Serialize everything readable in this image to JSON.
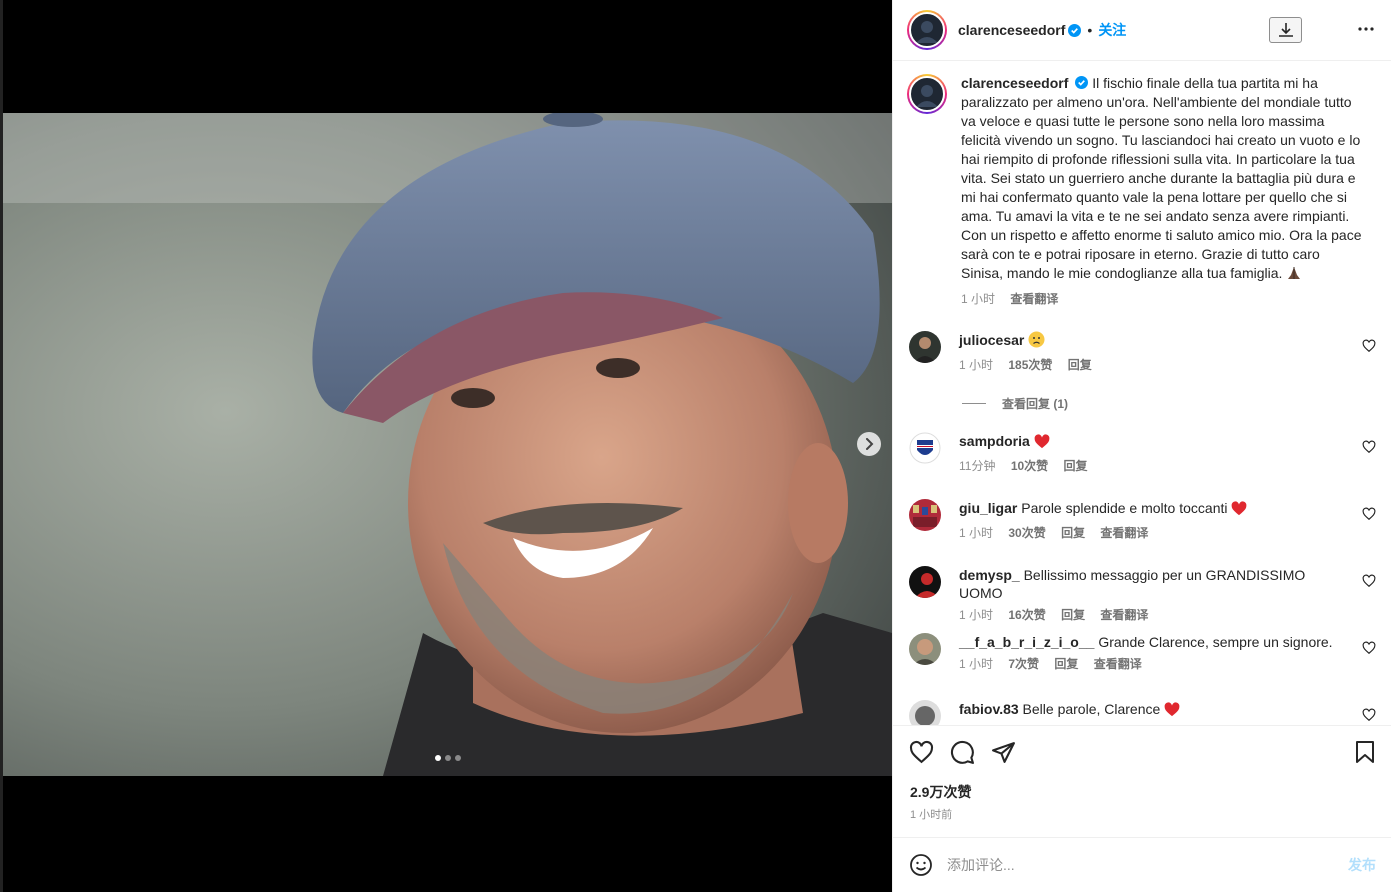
{
  "post": {
    "username": "clarenceseedorf",
    "follow_label": "关注",
    "caption": "Il fischio finale della tua partita mi ha paralizzato per almeno un'ora. Nell'ambiente del mondiale tutto va veloce e quasi tutte le persone sono nella loro massima felicità vivendo un sogno. Tu lasciandoci hai creato un vuoto e lo hai riempito di profonde riflessioni sulla vita. In particolare la tua vita. Sei stato un guerriero anche durante la battaglia più dura e mi hai confermato quanto vale la pena lottare per quello che si ama. Tu amavi la vita e te ne sei andato senza avere rimpianti. Con un rispetto e affetto enorme ti saluto amico mio. Ora la pace sarà con te e potrai riposare in eterno. Grazie di tutto caro Sinisa, mando le mie condoglianze alla tua famiglia.",
    "caption_time": "1 小时",
    "caption_translate": "查看翻译",
    "likes": "2.9万次赞",
    "time_ago": "1 小时前",
    "carousel": {
      "count": 3,
      "active": 0
    }
  },
  "comments": [
    {
      "username": "juliocesar",
      "text": "",
      "emoji": "sad-face",
      "time": "1 小时",
      "likes": "185次赞",
      "reply": "回复",
      "translate": ""
    },
    {
      "username": "sampdoria",
      "text": "",
      "emoji": "red-heart",
      "time": "11分钟",
      "likes": "10次赞",
      "reply": "回复",
      "translate": ""
    },
    {
      "username": "giu_ligar",
      "text": "Parole splendide e molto toccanti",
      "emoji": "red-heart",
      "time": "1 小时",
      "likes": "30次赞",
      "reply": "回复",
      "translate": "查看翻译"
    },
    {
      "username": "demysp_",
      "text": "Bellissimo messaggio per un GRANDISSIMO UOMO",
      "emoji": "",
      "time": "1 小时",
      "likes": "16次赞",
      "reply": "回复",
      "translate": "查看翻译"
    },
    {
      "username": "__f_a_b_r_i_z_i_o__",
      "text": "Grande Clarence, sempre un signore.",
      "emoji": "",
      "time": "1 小时",
      "likes": "7次赞",
      "reply": "回复",
      "translate": "查看翻译"
    },
    {
      "username": "fabiov.83",
      "text": "Belle parole, Clarence",
      "emoji": "red-heart",
      "time": "",
      "likes": "",
      "reply": "",
      "translate": ""
    }
  ],
  "view_replies": "查看回复 (1)",
  "add_comment": {
    "placeholder": "添加评论...",
    "post_label": "发布"
  },
  "icons": [
    "verified-badge-icon",
    "download-icon",
    "more-icon",
    "chevron-right-icon",
    "heart-icon",
    "comment-icon",
    "share-icon",
    "bookmark-icon",
    "emoji-icon"
  ],
  "colors": {
    "accent": "#0095f6",
    "muted": "#8e8e8e",
    "heart_red": "#ed4956"
  }
}
